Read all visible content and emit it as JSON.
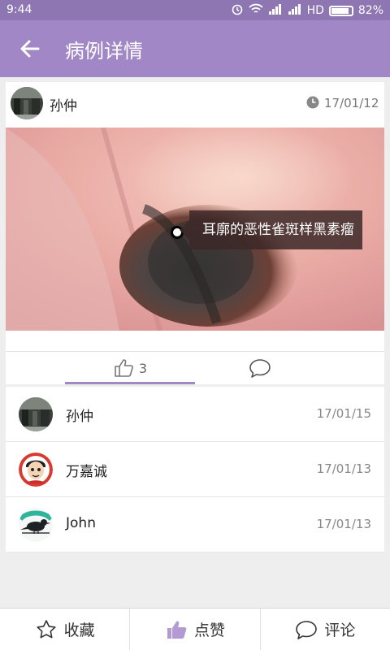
{
  "status_bar": {
    "time": "9:44",
    "network": "HD",
    "battery": "82%"
  },
  "app_bar": {
    "title": "病例详情",
    "back_icon": "arrow-left-icon"
  },
  "post": {
    "author": "孙仲",
    "date": "17/01/12",
    "image_tag": "耳廓的恶性雀斑样黑素瘤"
  },
  "tabs": {
    "like_count": "3"
  },
  "likers": [
    {
      "name": "孙仲",
      "date": "17/01/15"
    },
    {
      "name": "万嘉诚",
      "date": "17/01/13"
    },
    {
      "name": "John",
      "date": "17/01/13"
    }
  ],
  "bottom_bar": {
    "favorite": "收藏",
    "like": "点赞",
    "comment": "评论"
  },
  "colors": {
    "accent": "#a287c6",
    "status": "#8d76b1"
  }
}
